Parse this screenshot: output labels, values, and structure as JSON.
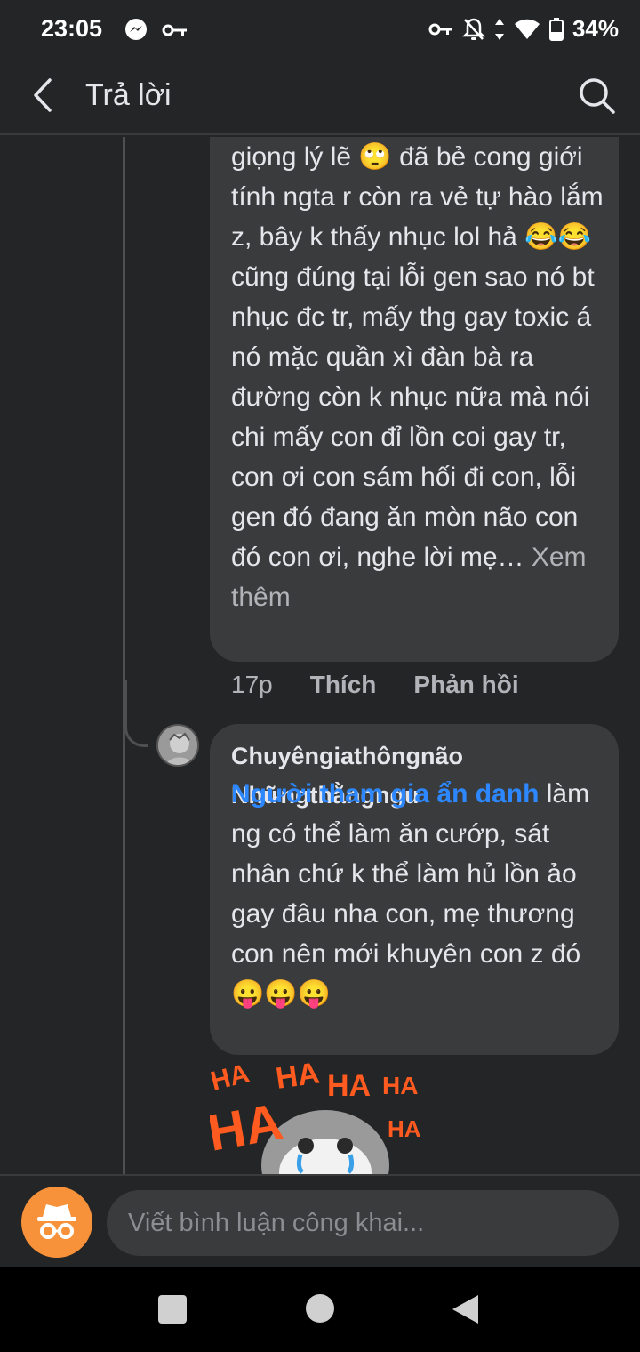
{
  "status_bar": {
    "time": "23:05",
    "battery": "34%",
    "icons": [
      "messenger-icon",
      "key-icon",
      "vpn-key-icon",
      "bell-off-icon",
      "data-arrows-icon",
      "wifi-icon",
      "battery-icon"
    ]
  },
  "header": {
    "title": "Trả lời",
    "back_icon": "back-arrow-icon",
    "search_icon": "search-icon"
  },
  "comments": [
    {
      "text_parts": [
        "giọng lý lẽ 🙄 đã bẻ cong giới tính ngta r còn ra vẻ tự hào lắm z, bây k thấy nhục lol hả 😂😂 cũng đúng tại lỗi gen sao nó bt nhục đc tr, mấy thg gay toxic á nó mặc quần xì đàn bà ra đường còn k nhục nữa mà nói chi mấy con đỉ lồn coi gay tr, con ơi con sám hối đi con, lỗi gen đó đang ăn mòn não con đó con ơi, nghe lời mẹ… ",
        "Xem thêm"
      ],
      "time": "17p",
      "like_label": "Thích",
      "reply_label": "Phản hồi"
    },
    {
      "author": "Chuyêngiathôngnão Nhữngthằngngu",
      "mention": "Người tham gia ẩn danh",
      "text": " làm ng có thể làm ăn cướp, sát nhân chứ k thể làm hủ lồn ảo gay đâu nha con, mẹ thương con nên mới khuyên con z đó 😛😛😛",
      "sticker_text": [
        "HA",
        "HA",
        "HA",
        "HA",
        "HA",
        "HA"
      ]
    }
  ],
  "composer": {
    "placeholder": "Viết bình luận công khai...",
    "anon_icon": "incognito-icon"
  },
  "nav_bar": {
    "icons": [
      "recent-apps-icon",
      "home-icon",
      "back-icon"
    ]
  },
  "colors": {
    "background": "#242526",
    "bubble": "#3a3b3c",
    "mention": "#2d88ff",
    "anon_button": "#f7923a",
    "secondary_text": "#b0b3b8"
  }
}
